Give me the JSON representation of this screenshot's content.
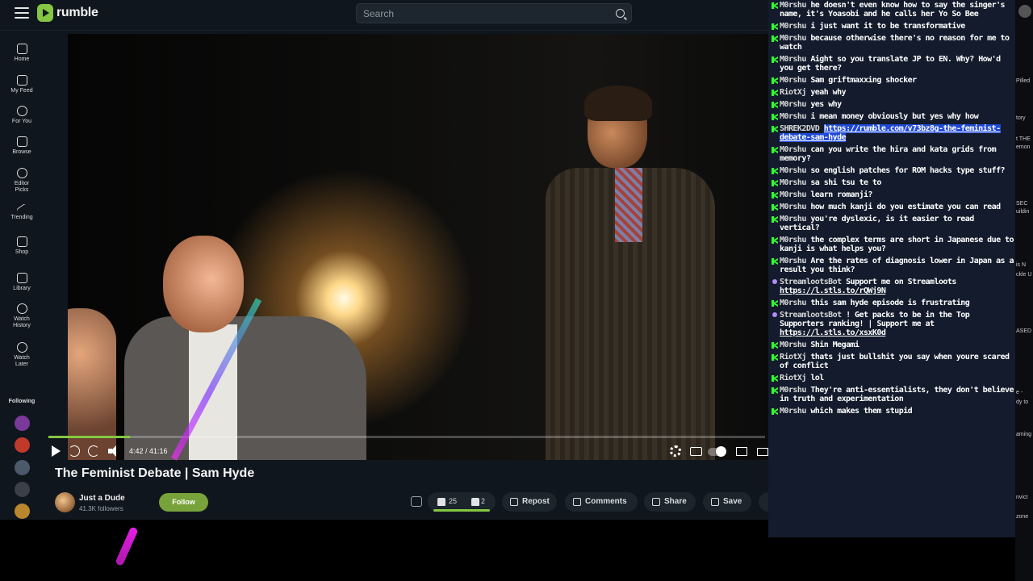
{
  "app": {
    "logo_text": "rumble",
    "search_placeholder": "Search"
  },
  "sidebar": {
    "items": [
      {
        "label": "Home",
        "icon": "home-icon"
      },
      {
        "label": "My Feed",
        "icon": "feed-icon"
      },
      {
        "label": "For You",
        "icon": "for-you-icon"
      },
      {
        "label": "Browse",
        "icon": "browse-icon"
      },
      {
        "label": "Editor Picks",
        "icon": "editor-picks-icon"
      },
      {
        "label": "Trending",
        "icon": "trending-icon"
      },
      {
        "label": "Shop",
        "icon": "shop-icon"
      },
      {
        "label": "Library",
        "icon": "library-icon"
      },
      {
        "label": "Watch History",
        "icon": "history-icon"
      },
      {
        "label": "Watch Later",
        "icon": "watch-later-icon"
      }
    ],
    "following_label": "Following",
    "following_avatar_colors": [
      "#7a3a9c",
      "#c0392b",
      "#4a5a6a",
      "#3a3f48",
      "#b8872e"
    ]
  },
  "player": {
    "timecode": "4:42 / 41:16",
    "progress": 0.114
  },
  "video": {
    "title": "The Feminist Debate | Sam Hyde",
    "channel_name": "Just a Dude",
    "channel_followers": "41.3K followers",
    "follow_label": "Follow",
    "upvotes": "25",
    "downvotes": "2",
    "repost_label": "Repost",
    "comments_label": "Comments",
    "share_label": "Share",
    "save_label": "Save"
  },
  "chat": {
    "colors": {
      "bg": "#131b2c",
      "badge_green": "#33ff33",
      "badge_purple": "#b38cf7",
      "highlight": "#1f49d8"
    },
    "messages": [
      {
        "user": "M0rshu",
        "badge": "green",
        "text": "he doesn't even know how to say the singer's name, it's Yoasobi and he calls her Yo So Bee"
      },
      {
        "user": "M0rshu",
        "badge": "green",
        "text": "i just want it to be transformative"
      },
      {
        "user": "M0rshu",
        "badge": "green",
        "text": "because otherwise there's no reason for me to watch"
      },
      {
        "user": "M0rshu",
        "badge": "green",
        "text": "Aight so you translate JP to EN. Why? How'd you get there?"
      },
      {
        "user": "M0rshu",
        "badge": "green",
        "text": "Sam griftmaxxing shocker"
      },
      {
        "user": "RiotXj",
        "badge": "green",
        "text": "yeah why"
      },
      {
        "user": "M0rshu",
        "badge": "green",
        "text": "yes why"
      },
      {
        "user": "M0rshu",
        "badge": "green",
        "text": "i mean money obviously but yes why how"
      },
      {
        "user": "SHREK2DVD",
        "badge": "green",
        "text": "",
        "link": "https://rumble.com/v73bz8g-the-feminist-debate-sam-hyde",
        "highlight": true
      },
      {
        "user": "M0rshu",
        "badge": "green",
        "text": "can you write the hira and kata grids from memory?"
      },
      {
        "user": "M0rshu",
        "badge": "green",
        "text": "so english patches for ROM hacks type stuff?"
      },
      {
        "user": "M0rshu",
        "badge": "green",
        "text": "sa shi tsu te to"
      },
      {
        "user": "M0rshu",
        "badge": "green",
        "text": "learn romanji?"
      },
      {
        "user": "M0rshu",
        "badge": "green",
        "text": "how much kanji do you estimate you can read"
      },
      {
        "user": "M0rshu",
        "badge": "green",
        "text": "you're dyslexic, is it easier to read vertical?"
      },
      {
        "user": "M0rshu",
        "badge": "green",
        "text": "the complex terms are short in Japanese due to kanji is what helps you?"
      },
      {
        "user": "M0rshu",
        "badge": "green",
        "text": "Are the rates of diagnosis lower in Japan as a result you think?"
      },
      {
        "user": "StreamlootsBot",
        "badge": "purple",
        "text": "Support me on Streamloots",
        "link": "https://l.stls.to/rQWj9N"
      },
      {
        "user": "M0rshu",
        "badge": "green",
        "text": "this sam hyde episode is frustrating"
      },
      {
        "user": "StreamlootsBot",
        "badge": "purple",
        "text": "! Get packs to be in the Top Supporters ranking! | Support me at",
        "link": "https://l.stls.to/xsxK0d"
      },
      {
        "user": "M0rshu",
        "badge": "green",
        "text": "Shin Megami"
      },
      {
        "user": "RiotXj",
        "badge": "green",
        "text": "thats just bullshit you say when youre scared of conflict"
      },
      {
        "user": "RiotXj",
        "badge": "green",
        "text": "lol"
      },
      {
        "user": "M0rshu",
        "badge": "green",
        "text": "They're anti-essentialists, they don't believe in truth and experimentation"
      },
      {
        "user": "M0rshu",
        "badge": "green",
        "text": "which makes them stupid"
      }
    ]
  },
  "right_strip": {
    "snippets": [
      "Pilled",
      "tory",
      "t THE",
      "emon",
      "SEC",
      "uildin",
      "is N",
      "ckle U",
      "ASED",
      "e -",
      "dy to",
      "aming",
      "nvict",
      "zone"
    ]
  }
}
